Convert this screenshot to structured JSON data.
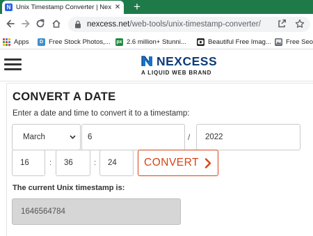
{
  "browser": {
    "tab": {
      "favicon": "N",
      "title": "Unix Timestamp Converter | Nex",
      "close_glyph": "✕"
    },
    "new_tab_glyph": "+",
    "url_domain": "nexcess.net",
    "url_path": "/web-tools/unix-timestamp-converter/",
    "tabbar_color": "#1f7a49"
  },
  "bookmarks": [
    {
      "label": "Apps",
      "icon": "apps-grid-icon"
    },
    {
      "label": "Free Stock Photos,...",
      "icon": "D"
    },
    {
      "label": "2.6 million+ Stunni...",
      "icon": "px"
    },
    {
      "label": "Beautiful Free Imag...",
      "icon": "camera-icon"
    },
    {
      "label": "Free Seo T",
      "icon": "gallery-icon"
    }
  ],
  "site": {
    "logo_word": "NEXCESS",
    "logo_tagline": "A LIQUID WEB BRAND",
    "brand_color": "#0e3c78",
    "accent_color": "#d84315"
  },
  "converter": {
    "title": "CONVERT A DATE",
    "instruction": "Enter a date and time to convert it to a timestamp:",
    "month": "March",
    "day": "6",
    "date_separator": "/",
    "year": "2022",
    "hour": "16",
    "time_separator": ":",
    "minute": "36",
    "second": "24",
    "convert_label": "CONVERT",
    "current_label": "The current Unix timestamp is:",
    "current_timestamp": "1646564784"
  }
}
